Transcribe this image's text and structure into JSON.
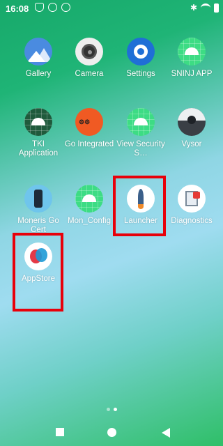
{
  "status_bar": {
    "time": "16:08",
    "icons": [
      "shield-icon",
      "dk-icon",
      "circle-icon"
    ],
    "right_icons": [
      "bluetooth-icon",
      "wifi-icon",
      "battery-icon"
    ]
  },
  "apps": [
    {
      "label": "Gallery",
      "icon": "gallery-icon"
    },
    {
      "label": "Camera",
      "icon": "camera-icon"
    },
    {
      "label": "Settings",
      "icon": "settings-icon"
    },
    {
      "label": "SNINJ APP",
      "icon": "android-icon"
    },
    {
      "label": "TKI Application",
      "icon": "android-icon"
    },
    {
      "label": "Go Integrated",
      "icon": "go-integrated-icon"
    },
    {
      "label": "View Security S…",
      "icon": "android-icon"
    },
    {
      "label": "Vysor",
      "icon": "vysor-icon"
    },
    {
      "label": "Moneris Go Cert",
      "icon": "moneris-icon"
    },
    {
      "label": "Mon_Config",
      "icon": "android-icon"
    },
    {
      "label": "Launcher",
      "icon": "launcher-icon"
    },
    {
      "label": "Diagnostics",
      "icon": "diagnostics-icon"
    },
    {
      "label": "AppStore",
      "icon": "appstore-icon"
    }
  ],
  "highlight_color": "#e8000a",
  "pager": {
    "pages": 2,
    "active": 2
  },
  "nav": {
    "buttons": [
      "recents-icon",
      "home-icon",
      "back-icon"
    ]
  }
}
